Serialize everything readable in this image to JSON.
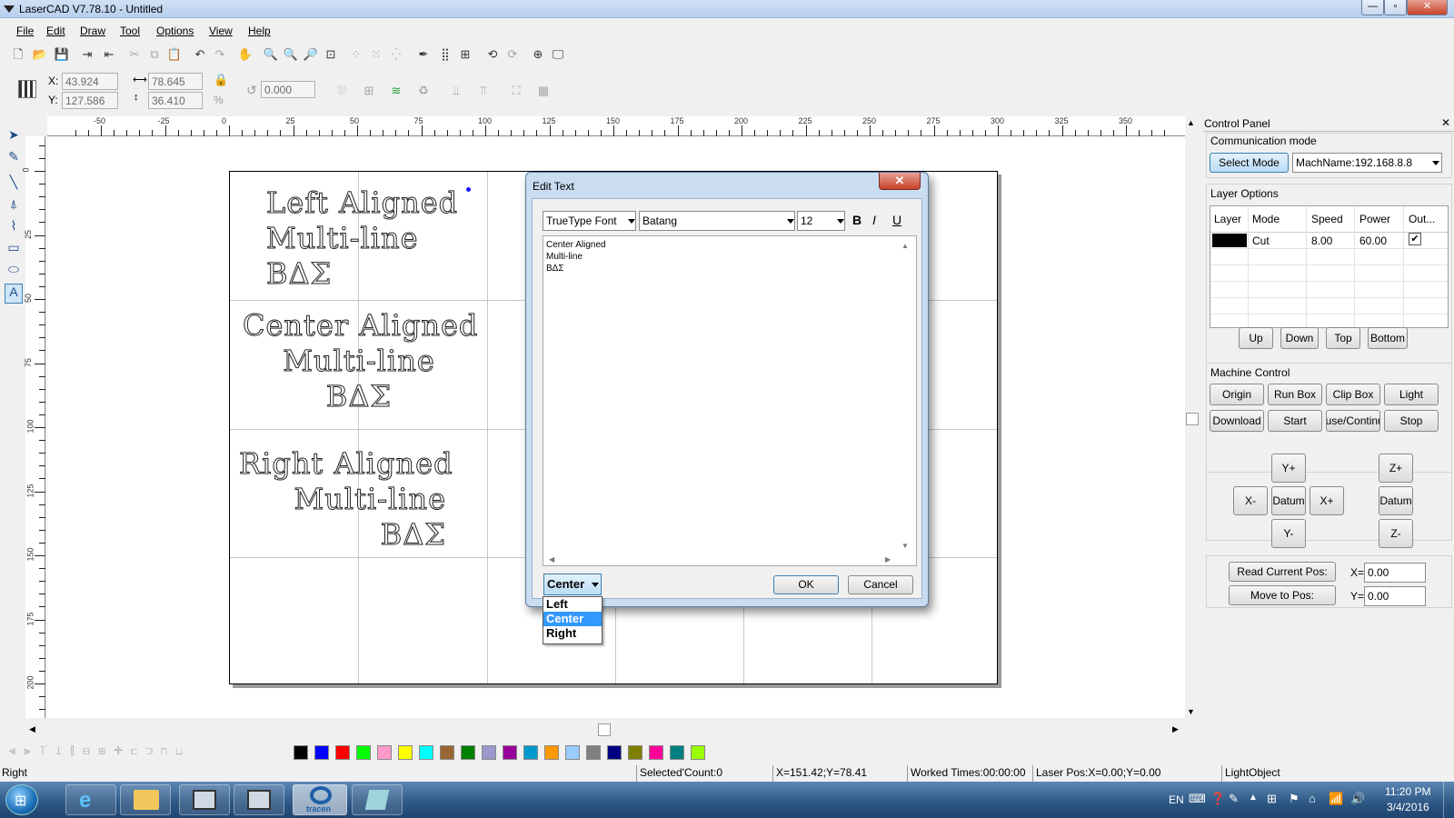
{
  "window": {
    "title": "LaserCAD V7.78.10 - Untitled",
    "min_label": "—",
    "max_label": "▫",
    "close_label": "✕"
  },
  "menu": [
    {
      "label": "File"
    },
    {
      "label": "Edit"
    },
    {
      "label": "Draw"
    },
    {
      "label": "Tool"
    },
    {
      "label": "Options"
    },
    {
      "label": "View"
    },
    {
      "label": "Help"
    }
  ],
  "coords": {
    "x_label": "X:",
    "x": "43.924",
    "y_label": "Y:",
    "y": "127.586",
    "w": "78.645",
    "h": "36.410",
    "pct": "%",
    "angle": "0.000"
  },
  "ruler": {
    "top": [
      "-50",
      "-25",
      "0",
      "25",
      "50",
      "75",
      "100",
      "125",
      "150",
      "175",
      "200",
      "225",
      "250",
      "275",
      "300",
      "325",
      "350"
    ],
    "left": [
      "0",
      "25",
      "50",
      "75",
      "100",
      "125",
      "150",
      "175",
      "200"
    ]
  },
  "canvas_text": {
    "left": [
      "Left Aligned",
      "Multi-line",
      "BΔΣ"
    ],
    "center": [
      "Center Aligned",
      "Multi-line",
      "BΔΣ"
    ],
    "right": [
      "Right Aligned",
      "Multi-line",
      "BΔΣ"
    ]
  },
  "dialog": {
    "title": "Edit Text",
    "font_type": "TrueType Font",
    "font_name": "Batang",
    "font_size": "12",
    "bold": "B",
    "italic": "I",
    "underline": "U",
    "text_lines": [
      "Center Aligned",
      "Multi-line",
      "BΔΣ"
    ],
    "align_value": "Center",
    "align_options": [
      "Left",
      "Center",
      "Right"
    ],
    "ok": "OK",
    "cancel": "Cancel"
  },
  "control_panel": {
    "title": "Control Panel",
    "comm_mode_label": "Communication mode",
    "select_mode": "Select Mode",
    "machine": "MachName:192.168.8.8",
    "layer_options_label": "Layer Options",
    "layer_headers": [
      "Layer",
      "Mode",
      "Speed",
      "Power",
      "Out..."
    ],
    "layers": [
      {
        "color": "#000000",
        "mode": "Cut",
        "speed": "8.00",
        "power": "60.00",
        "output": "✔"
      }
    ],
    "layer_buttons": [
      "Up",
      "Down",
      "Top",
      "Bottom"
    ],
    "machine_control_label": "Machine Control",
    "machine_buttons": [
      "Origin",
      "Run Box",
      "Clip Box",
      "Light",
      "Download",
      "Start",
      "Pause/Continue",
      "Stop"
    ],
    "jog": {
      "y_plus": "Y+",
      "x_minus": "X-",
      "datum": "Datum",
      "x_plus": "X+",
      "y_minus": "Y-",
      "z_plus": "Z+",
      "z_datum": "Datum",
      "z_minus": "Z-"
    },
    "read_pos": "Read Current Pos:",
    "move_pos": "Move to Pos:",
    "x_label": "X=",
    "x_val": "0.00",
    "y_label": "Y=",
    "y_val": "0.00"
  },
  "palette": [
    "#000000",
    "#0000ff",
    "#ff0000",
    "#00ff00",
    "#ff99cc",
    "#ffff00",
    "#00ffff",
    "#996633",
    "#008000",
    "#9999cc",
    "#990099",
    "#0099cc",
    "#ff9900",
    "#99ccff",
    "#808080",
    "#000080",
    "#808000",
    "#ff0099",
    "#008080",
    "#99ff00"
  ],
  "status": {
    "mode": "Right",
    "selected": "Selected'Count:0",
    "pos": "X=151.42;Y=78.41",
    "worked": "Worked Times:00:00:00",
    "laser": "Laser Pos:X=0.00;Y=0.00",
    "brand": "LightObject"
  },
  "taskbar": {
    "lang": "EN",
    "time": "11:20 PM",
    "date": "3/4/2016",
    "tracen": "tracen"
  }
}
